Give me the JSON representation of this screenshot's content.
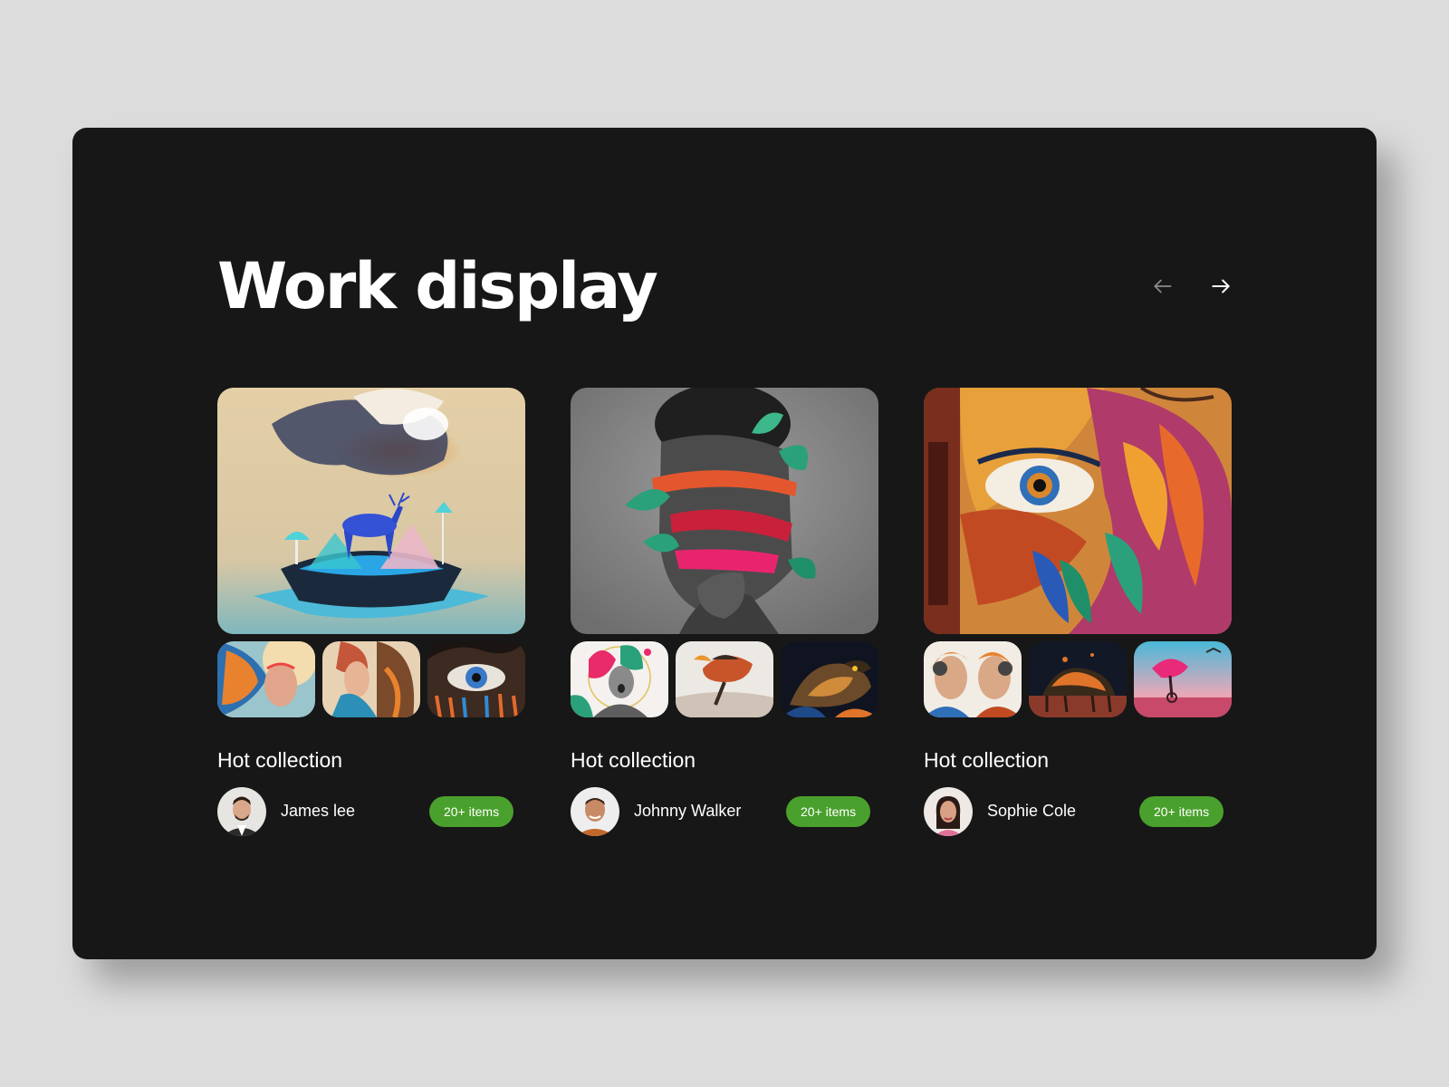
{
  "page": {
    "title": "Work display"
  },
  "navigation": {
    "prev_icon": "arrow-left-icon",
    "next_icon": "arrow-right-icon"
  },
  "colors": {
    "page_background": "#dcdcdc",
    "panel_background": "#171717",
    "badge_green": "#4aa02c",
    "text_primary": "#ffffff",
    "nav_disabled": "#8a8a8a"
  },
  "collections": [
    {
      "title": "Hot collection",
      "author": "James lee",
      "badge": "20+ items"
    },
    {
      "title": "Hot collection",
      "author": "Johnny Walker",
      "badge": "20+ items"
    },
    {
      "title": "Hot collection",
      "author": "Sophie Cole",
      "badge": "20+ items"
    }
  ]
}
